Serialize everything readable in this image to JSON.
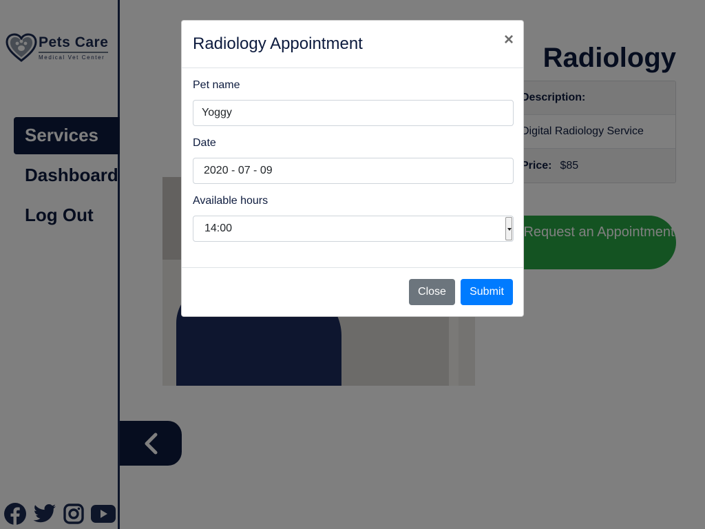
{
  "sidebar": {
    "logo": {
      "title": "Pets Care",
      "subtitle": "Medical Vet Center"
    },
    "nav": [
      {
        "label": "Services",
        "active": true
      },
      {
        "label": "Dashboard",
        "active": false
      },
      {
        "label": "Log Out",
        "active": false
      }
    ],
    "social_icons": [
      "facebook-icon",
      "twitter-icon",
      "instagram-icon",
      "youtube-icon"
    ]
  },
  "service": {
    "title": "Radiology",
    "description_label": "Description:",
    "description": "Digital Radiology Service",
    "price_label": "Price:",
    "price": "$85",
    "request_button": "Request an Appointment",
    "request_icon": "calendar-check-icon",
    "back_icon": "chevron-left-icon"
  },
  "modal": {
    "title": "Radiology Appointment",
    "close_symbol": "×",
    "fields": {
      "pet_name": {
        "label": "Pet name",
        "value": "Yoggy"
      },
      "date": {
        "label": "Date",
        "value": "2020 - 07 - 09"
      },
      "hours": {
        "label": "Available hours",
        "value": "14:00"
      }
    },
    "close_button": "Close",
    "submit_button": "Submit"
  },
  "colors": {
    "navy": "#0d1b3e",
    "green": "#28a745",
    "blue": "#007bff",
    "gray": "#6c757d"
  }
}
